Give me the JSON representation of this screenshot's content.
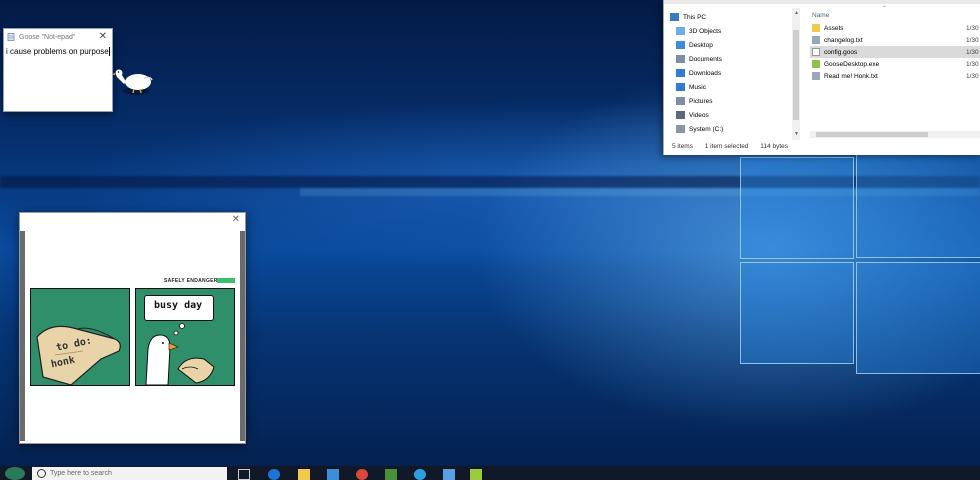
{
  "notepad": {
    "title": "Goose \"Not-epad\"",
    "close_glyph": "✕",
    "text": "i cause problems on purpose"
  },
  "comic": {
    "close_glyph": "✕",
    "header": "SAFELY ENDANGERED",
    "panel1_text_line1": "to do:",
    "panel1_text_line2": "honk",
    "panel2_text": "busy day"
  },
  "explorer": {
    "nav": [
      {
        "label": "This PC",
        "icon": "computer-icon",
        "color": "#3a79c5"
      },
      {
        "label": "3D Objects",
        "icon": "cube-icon",
        "color": "#6ab0e6"
      },
      {
        "label": "Desktop",
        "icon": "desktop-icon",
        "color": "#3a8fd8"
      },
      {
        "label": "Documents",
        "icon": "documents-icon",
        "color": "#7e8ea6"
      },
      {
        "label": "Downloads",
        "icon": "downloads-icon",
        "color": "#2f7bd6"
      },
      {
        "label": "Music",
        "icon": "music-icon",
        "color": "#2f7bd6"
      },
      {
        "label": "Pictures",
        "icon": "pictures-icon",
        "color": "#7e8ea6"
      },
      {
        "label": "Videos",
        "icon": "videos-icon",
        "color": "#5a6a7a"
      },
      {
        "label": "System (C:)",
        "icon": "drive-icon",
        "color": "#8a96a6"
      }
    ],
    "column_name": "Name",
    "files": [
      {
        "name": "Assets",
        "date": "1/30",
        "icon": "folder-icon",
        "color": "#f2c94c"
      },
      {
        "name": "changelog.txt",
        "date": "1/30",
        "icon": "text-file-icon",
        "color": "#9aa7b5"
      },
      {
        "name": "config.goos",
        "date": "1/30",
        "icon": "file-icon",
        "color": "#ffffff"
      },
      {
        "name": "GooseDesktop.exe",
        "date": "1/30",
        "icon": "goose-exe-icon",
        "color": "#8bc34a"
      },
      {
        "name": "Read me! Honk.txt",
        "date": "1/30",
        "icon": "text-file-icon",
        "color": "#9aa7b5"
      }
    ],
    "selected_index": 2,
    "status_items": "5 items",
    "status_selected": "1 item selected",
    "status_size": "114 bytes"
  },
  "taskbar": {
    "search_placeholder": "Type here to search"
  }
}
